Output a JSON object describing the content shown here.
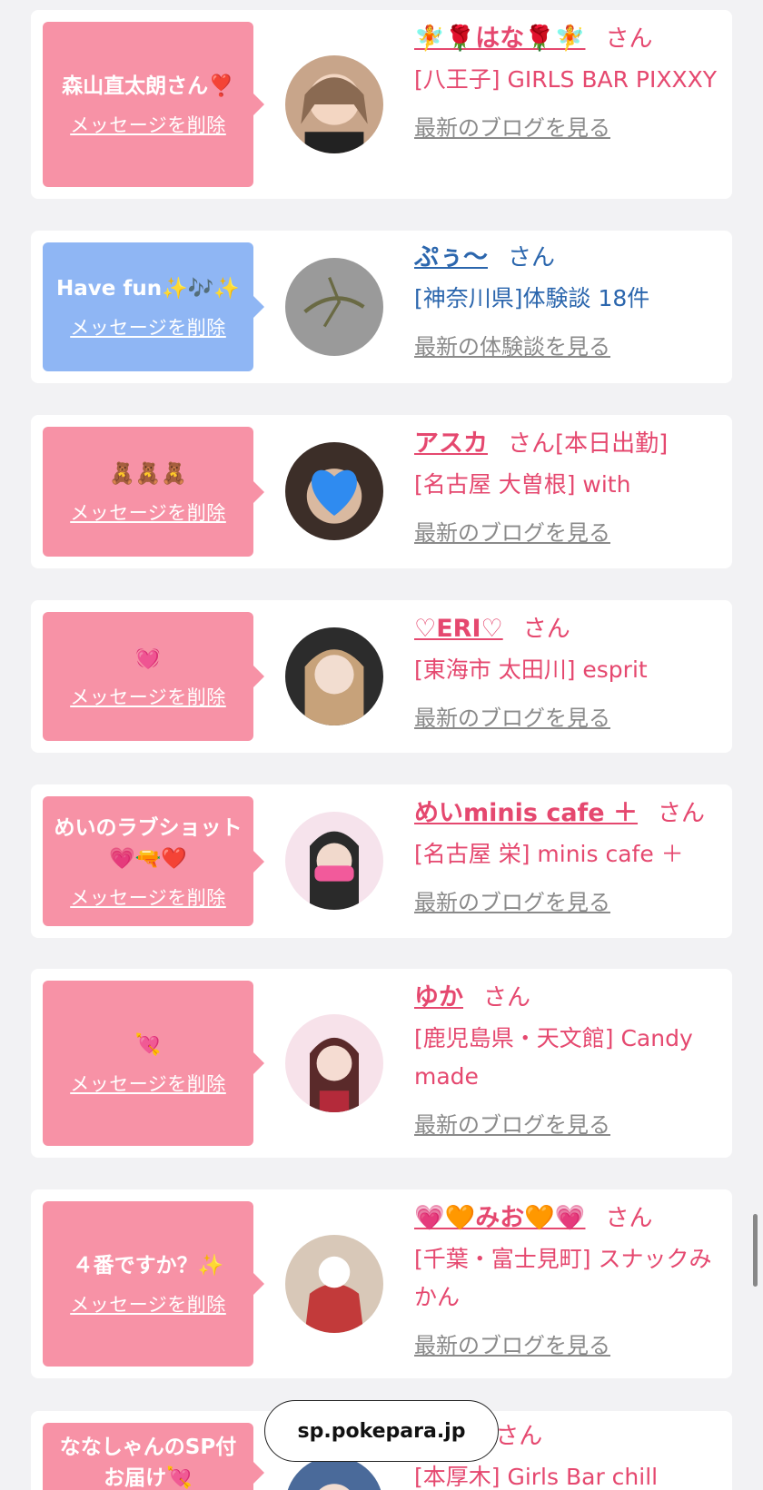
{
  "delete_label": "メッセージを削除",
  "honorific": "さん",
  "cards": [
    {
      "message": "森山直太朗さん❣️",
      "name": "🧚🌹はな🌹🧚",
      "suffix": "",
      "shop": "[八王子] GIRLS BAR PIXXXY",
      "link": "最新のブログを見る",
      "theme": "pink"
    },
    {
      "message": "Have fun✨🎶✨",
      "name": "ぷぅ〜",
      "suffix": "",
      "shop": "[神奈川県]体験談 18件",
      "link": "最新の体験談を見る",
      "theme": "blue"
    },
    {
      "message": "🧸🧸🧸",
      "name": "アスカ",
      "suffix": "[本日出勤]",
      "shop": "[名古屋 大曽根] with",
      "link": "最新のブログを見る",
      "theme": "pink"
    },
    {
      "message": "💓",
      "name": "♡ERI♡",
      "suffix": "",
      "shop": "[東海市 太田川] esprit",
      "link": "最新のブログを見る",
      "theme": "pink"
    },
    {
      "message": "めいのラブショット💗🔫❤️",
      "name": "めいminis cafe ＋",
      "suffix": "",
      "shop": "[名古屋 栄] minis cafe ＋",
      "link": "最新のブログを見る",
      "theme": "pink"
    },
    {
      "message": "💘",
      "name": "ゆか",
      "suffix": "",
      "shop": "[鹿児島県・天文館] Candy made",
      "link": "最新のブログを見る",
      "theme": "pink"
    },
    {
      "message": "４番ですか？✨",
      "name": "💗🧡みお🧡💗",
      "suffix": "",
      "shop": "[千葉・富士見町] スナックみかん",
      "link": "最新のブログを見る",
      "theme": "pink"
    },
    {
      "message": "ななしゃんのSP付 お届け💘",
      "name": "🎀🎀",
      "suffix": "",
      "shop": "[本厚木] Girls Bar chill",
      "link": "",
      "theme": "pink"
    }
  ],
  "browser": {
    "url": "sp.pokepara.jp"
  },
  "colors": {
    "pink_bubble": "#f792a6",
    "blue_bubble": "#8fb6f4",
    "pink_text": "#e5486f",
    "blue_text": "#2b66ad"
  }
}
